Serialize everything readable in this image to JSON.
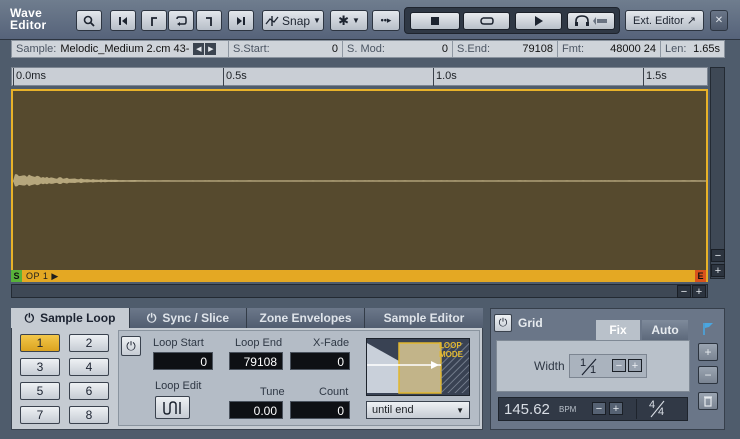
{
  "window": {
    "title_line1": "Wave",
    "title_line2": "Editor"
  },
  "toolbar": {
    "snap_label": "Snap",
    "ext_editor_label": "Ext. Editor",
    "arrow_icon": "↗",
    "close_icon": "✕"
  },
  "info": {
    "sample_label": "Sample:",
    "sample_name": "Melodic_Medium 2.cm 43-",
    "start_label": "S.Start:",
    "start_value": "0",
    "mod_label": "S. Mod:",
    "mod_value": "0",
    "end_label": "S.End:",
    "end_value": "79108",
    "fmt_label": "Fmt:",
    "fmt_value": "48000 24",
    "len_label": "Len:",
    "len_value": "1.65s"
  },
  "ruler": {
    "ticks": [
      "0.0ms",
      "0.5s",
      "1.0s",
      "1.5s"
    ]
  },
  "waveform": {
    "op_label": "OP 1",
    "start_marker": "S",
    "end_marker": "E",
    "fill_color": "#564a2e",
    "loop_color": "#e4a823"
  },
  "tabs": {
    "sample_loop": "Sample Loop",
    "sync_slice": "Sync / Slice",
    "zone_envelopes": "Zone Envelopes",
    "sample_editor": "Sample Editor"
  },
  "loop": {
    "slots": [
      "1",
      "2",
      "3",
      "4",
      "5",
      "6",
      "7",
      "8"
    ],
    "selected_slot": "1",
    "loop_start_label": "Loop Start",
    "loop_start_value": "0",
    "loop_end_label": "Loop End",
    "loop_end_value": "79108",
    "xfade_label": "X-Fade",
    "xfade_value": "0",
    "loop_edit_label": "Loop Edit",
    "tune_label": "Tune",
    "tune_value": "0.00",
    "count_label": "Count",
    "count_value": "0",
    "loop_mode_label": "LOOP MODE",
    "mode_selected": "until end"
  },
  "grid": {
    "title": "Grid",
    "fix_tab": "Fix",
    "auto_tab": "Auto",
    "width_label": "Width",
    "width_value_num": "1",
    "width_value_den": "1",
    "bpm_value": "145.62",
    "bpm_unit": "BPM",
    "signature_num": "4",
    "signature_den": "4"
  }
}
